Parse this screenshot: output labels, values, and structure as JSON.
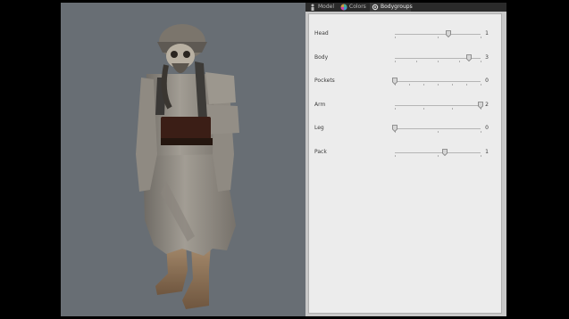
{
  "tabs": [
    {
      "label": "Model",
      "icon": "person-icon"
    },
    {
      "label": "Colors",
      "icon": "color-wheel-icon"
    },
    {
      "label": "Bodygroups",
      "icon": "gear-icon",
      "active": true
    }
  ],
  "bodygroups": [
    {
      "label": "Head",
      "value": "1",
      "level": 0.62,
      "ticks": 2
    },
    {
      "label": "Body",
      "value": "3",
      "level": 0.86,
      "ticks": 4
    },
    {
      "label": "Pockets",
      "value": "0",
      "level": 0.0,
      "ticks": 6
    },
    {
      "label": "Arm",
      "value": "2",
      "level": 1.0,
      "ticks": 3
    },
    {
      "label": "Leg",
      "value": "0",
      "level": 0.0,
      "ticks": 2
    },
    {
      "label": "Pack",
      "value": "1",
      "level": 0.58,
      "ticks": 2
    }
  ],
  "colors": {
    "viewport_bg": "#686e74",
    "panel_bg": "#ececec",
    "tab_active": "#3b3b3b"
  }
}
